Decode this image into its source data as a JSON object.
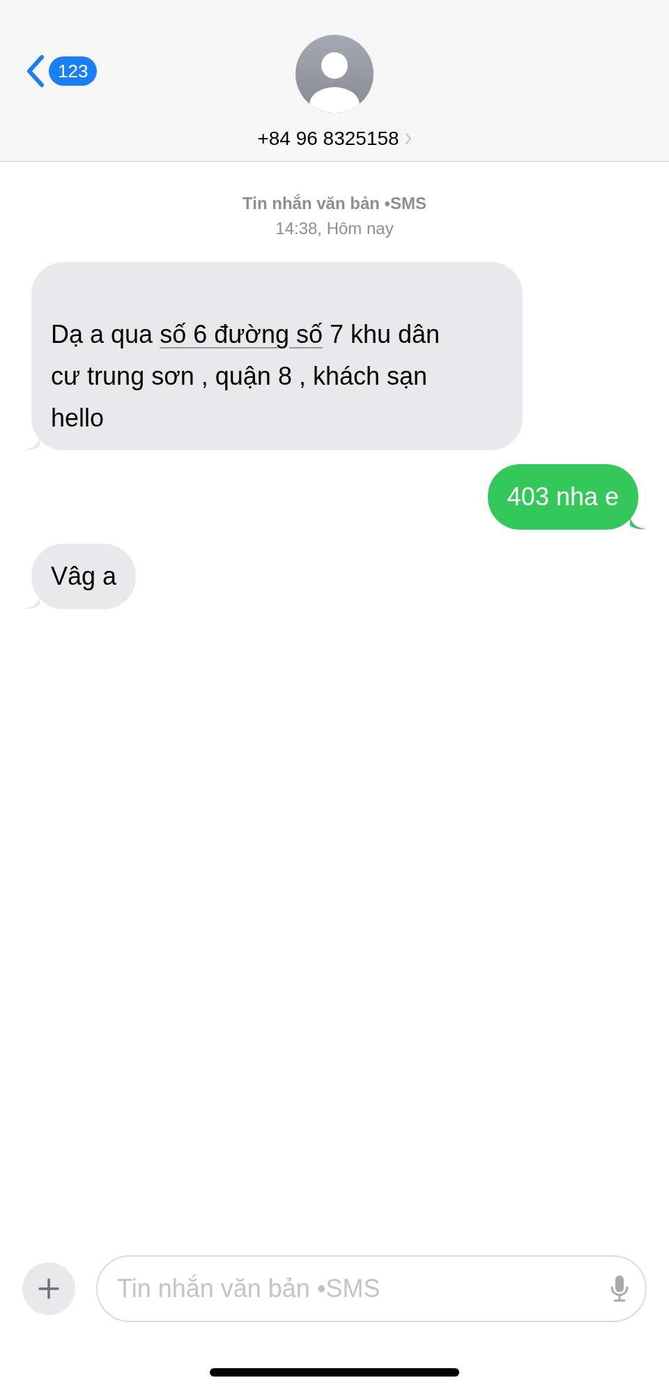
{
  "header": {
    "back_badge": "123",
    "contact": "+84 96 8325158"
  },
  "thread_info": {
    "service": "Tin nhắn văn bản •SMS",
    "time": "14:38, Hôm nay"
  },
  "messages": [
    {
      "kind": "received",
      "segments": [
        {
          "text": "Dạ a qua ",
          "detected": false
        },
        {
          "text": "số 6 đường số",
          "detected": true
        },
        {
          "text": " 7 khu dân cư trung sơn , quận 8 , khách sạn hello",
          "detected": false
        }
      ]
    },
    {
      "kind": "sent",
      "segments": [
        {
          "text": "403 nha e",
          "detected": false
        }
      ]
    },
    {
      "kind": "received",
      "segments": [
        {
          "text": "Vâg a",
          "detected": false
        }
      ]
    }
  ],
  "composer": {
    "placeholder": "Tin nhắn văn bản •SMS"
  }
}
